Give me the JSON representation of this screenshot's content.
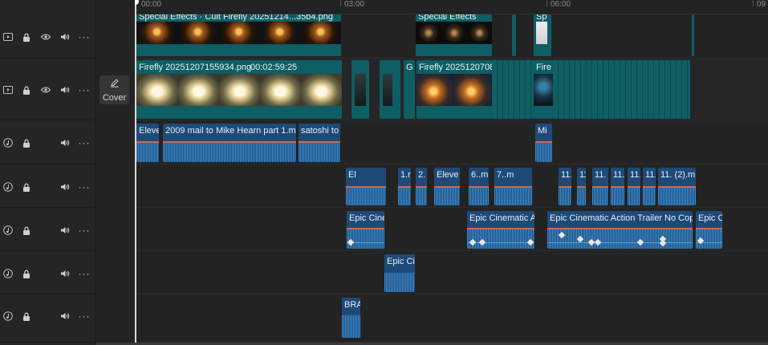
{
  "ruler": {
    "ticks": [
      "00:00",
      "03:00",
      "06:00",
      "09"
    ]
  },
  "cover": {
    "label": "Cover"
  },
  "tracks": [
    {
      "kind": "effects",
      "type_icon": "video-track-icon"
    },
    {
      "kind": "main-video",
      "type_icon": "video-track-icon"
    },
    {
      "kind": "audio",
      "type_icon": "audio-track-icon"
    },
    {
      "kind": "audio",
      "type_icon": "audio-track-icon"
    },
    {
      "kind": "audio",
      "type_icon": "audio-track-icon"
    },
    {
      "kind": "audio",
      "type_icon": "audio-track-icon"
    },
    {
      "kind": "audio",
      "type_icon": "audio-track-icon"
    }
  ],
  "clips": {
    "fx1": "Special Effects · Cult   Firefly 20251214...35b4.png",
    "fx2": "Special Effects",
    "fx3": "Sp",
    "mv1": "Firefly 20251207155934.png",
    "mv1_duration": "00:02:59:25",
    "mv2": "G",
    "mv3": "Firefly 20251207088",
    "mv4": "Fire",
    "a1_1": "Eleve",
    "a1_2": "2009 mail to Mike Hearn part 1.mp3",
    "a1_3": "satoshi to",
    "a1_4": "Mi",
    "a2_1": "El",
    "a2_2": "1.m",
    "a2_3": "2.",
    "a2_4": "Eleve",
    "a2_5": "6..mp",
    "a2_6": "7..m",
    "a2_7": "11.",
    "a2_8": "11",
    "a2_9": "11. (",
    "a2_10": "11.",
    "a2_11": "11.",
    "a2_12": "11.",
    "a2_13": "11. (2).mp",
    "a3_1": "Epic Ciner",
    "a3_2": "Epic Cinematic Ac",
    "a3_3": "Epic Cinematic Action Trailer No Copyrig",
    "a3_4": "Epic Ci",
    "a4_1": "Epic Cin",
    "a5_1": "BRA/"
  }
}
